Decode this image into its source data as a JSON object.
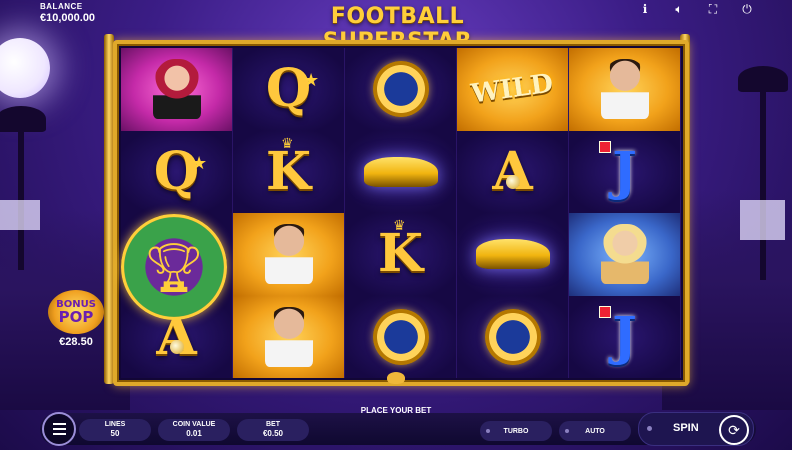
{
  "header": {
    "balance_label": "BALANCE",
    "balance_value": "€10,000.00",
    "logo": "FOOTBALL SUPERSTAR",
    "icons": [
      "info-icon",
      "sound-icon",
      "fullscreen-icon",
      "power-icon"
    ]
  },
  "reels": [
    [
      "woman-red",
      "queen",
      "wild-trophy",
      "ace"
    ],
    [
      "queen",
      "king",
      "footballer",
      "footballer"
    ],
    [
      "watch",
      "car",
      "king",
      "watch"
    ],
    [
      "wild",
      "ace",
      "car",
      "watch"
    ],
    [
      "footballer",
      "jack",
      "woman-blonde",
      "jack"
    ]
  ],
  "symbols": {
    "wild_text": "WILD",
    "queen": "Q",
    "king": "K",
    "ace": "A",
    "jack": "J"
  },
  "bonus": {
    "line1": "BONUS",
    "line2": "POP",
    "amount": "€28.50"
  },
  "status": {
    "message": "PLACE YOUR BET"
  },
  "controls": {
    "lines_label": "LINES",
    "lines_value": "50",
    "coin_label": "COIN VALUE",
    "coin_value": "0.01",
    "bet_label": "BET",
    "bet_value": "€0.50",
    "turbo_label": "TURBO",
    "auto_label": "AUTO",
    "spin_label": "SPIN"
  },
  "colors": {
    "frame_gold": "#e0a92a",
    "background": "#3b1d86",
    "logo_gold": "#ffcf3a"
  }
}
